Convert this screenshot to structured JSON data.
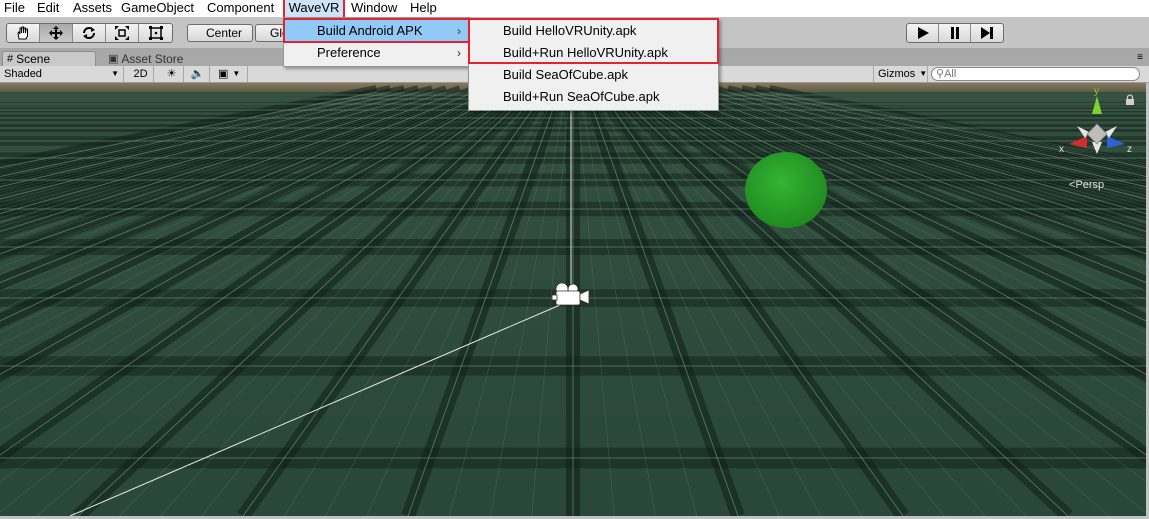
{
  "menubar": {
    "items": [
      "File",
      "Edit",
      "Assets",
      "GameObject",
      "Component",
      "WaveVR",
      "Window",
      "Help"
    ],
    "active": "WaveVR"
  },
  "toolbar": {
    "tools": [
      "hand-icon",
      "move-icon",
      "rotate-icon",
      "scale-icon",
      "rect-icon"
    ],
    "pivot_label": "Center",
    "global_label": "Global",
    "play_buttons": [
      "play-icon",
      "pause-icon",
      "step-icon"
    ]
  },
  "tabs": {
    "scene": "Scene",
    "asset_store": "Asset Store"
  },
  "scene_toolbar": {
    "shading_mode": "Shaded",
    "mode_2d": "2D",
    "gizmos": "Gizmos",
    "search_placeholder": "All"
  },
  "scene_view": {
    "persp_label": "Persp",
    "axis_labels": {
      "x": "x",
      "y": "y",
      "z": "z"
    }
  },
  "wavevr_menu": {
    "items": [
      {
        "label": "Build Android APK",
        "has_submenu": true,
        "highlighted": true
      },
      {
        "label": "Preference",
        "has_submenu": true,
        "highlighted": false
      }
    ]
  },
  "build_submenu": {
    "items": [
      "Build HelloVRUnity.apk",
      "Build+Run HelloVRUnity.apk",
      "Build SeaOfCube.apk",
      "Build+Run SeaOfCube.apk"
    ]
  },
  "colors": {
    "highlight_outline": "#e2222e",
    "menu_highlight": "#91c9f7",
    "ground": "#2c4a3a",
    "sphere": "#2aa52a"
  }
}
